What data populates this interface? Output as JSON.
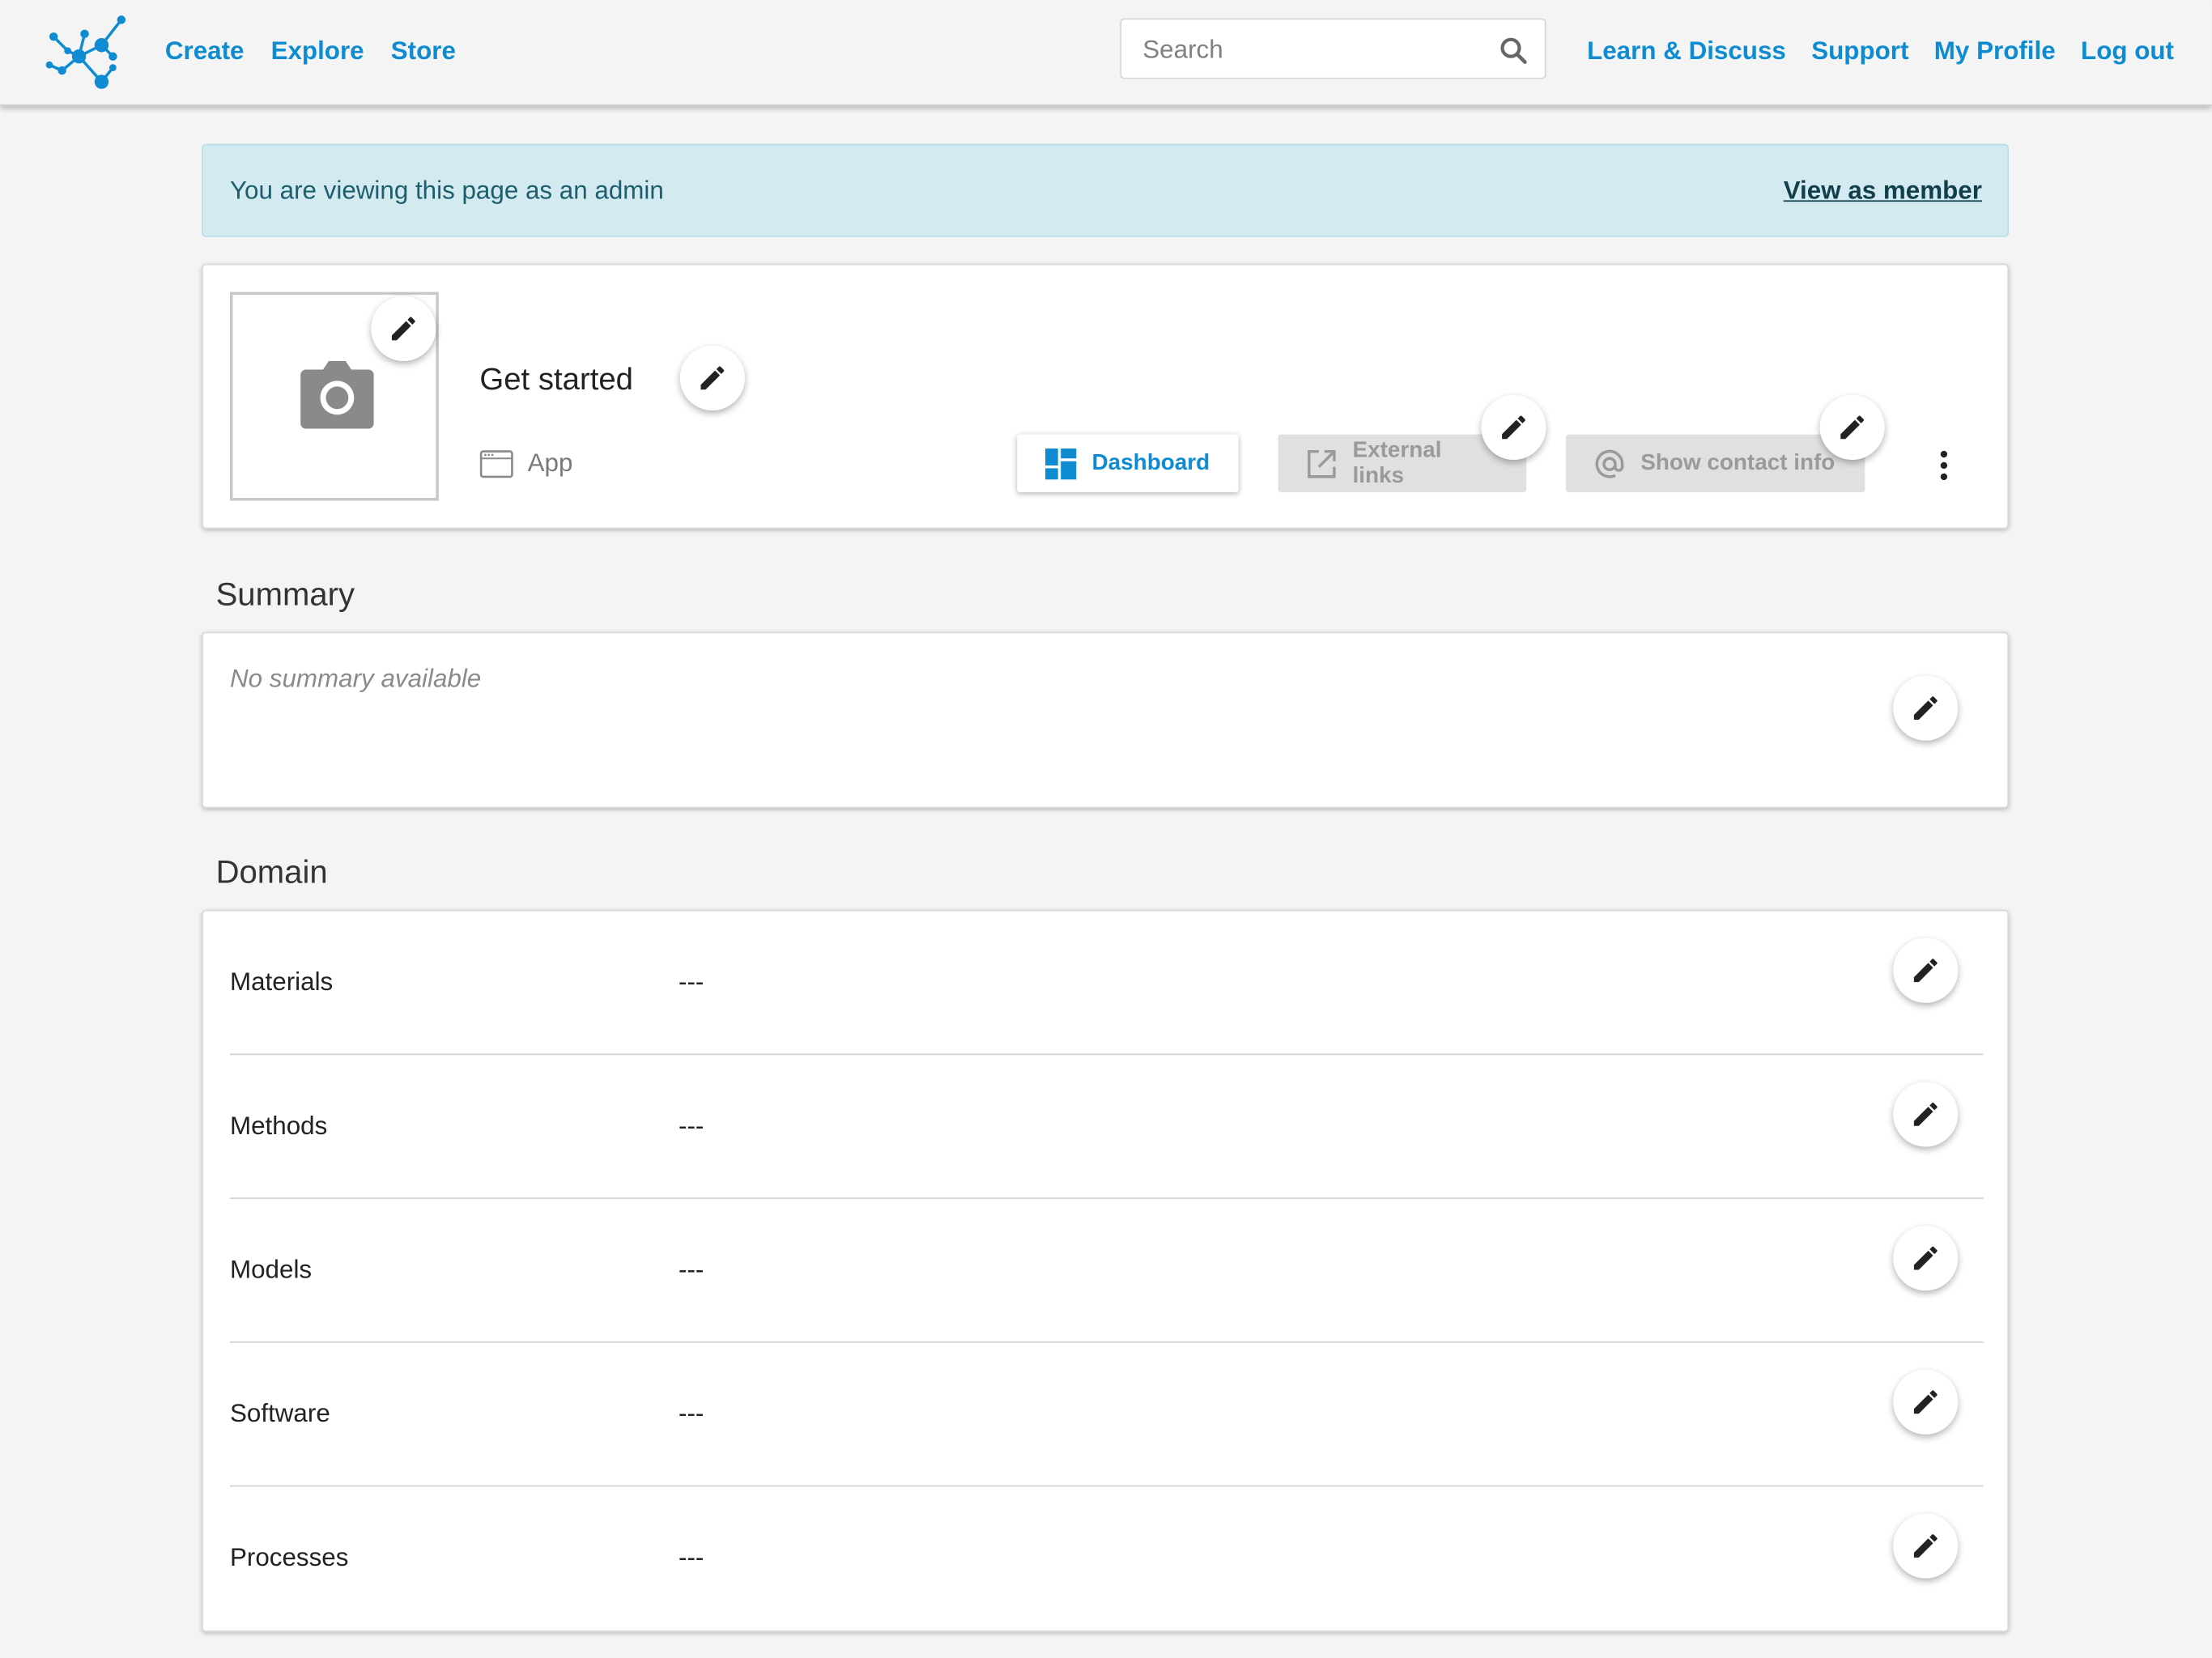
{
  "nav": {
    "left": [
      "Create",
      "Explore",
      "Store"
    ],
    "right": [
      "Learn & Discuss",
      "Support",
      "My Profile",
      "Log out"
    ],
    "search_placeholder": "Search"
  },
  "banner": {
    "message": "You are viewing this page as an admin",
    "action": "View as member"
  },
  "profile": {
    "title": "Get started",
    "type": "App",
    "buttons": {
      "dashboard": "Dashboard",
      "external": "External links",
      "contact": "Show contact info"
    }
  },
  "summary": {
    "heading": "Summary",
    "empty_text": "No summary available"
  },
  "domain": {
    "heading": "Domain",
    "rows": [
      {
        "label": "Materials",
        "value": "---"
      },
      {
        "label": "Methods",
        "value": "---"
      },
      {
        "label": "Models",
        "value": "---"
      },
      {
        "label": "Software",
        "value": "---"
      },
      {
        "label": "Processes",
        "value": "---"
      }
    ]
  },
  "colors": {
    "accent": "#0e8bd1",
    "banner_bg": "#d2eaf0",
    "background": "#f4f4f4"
  }
}
